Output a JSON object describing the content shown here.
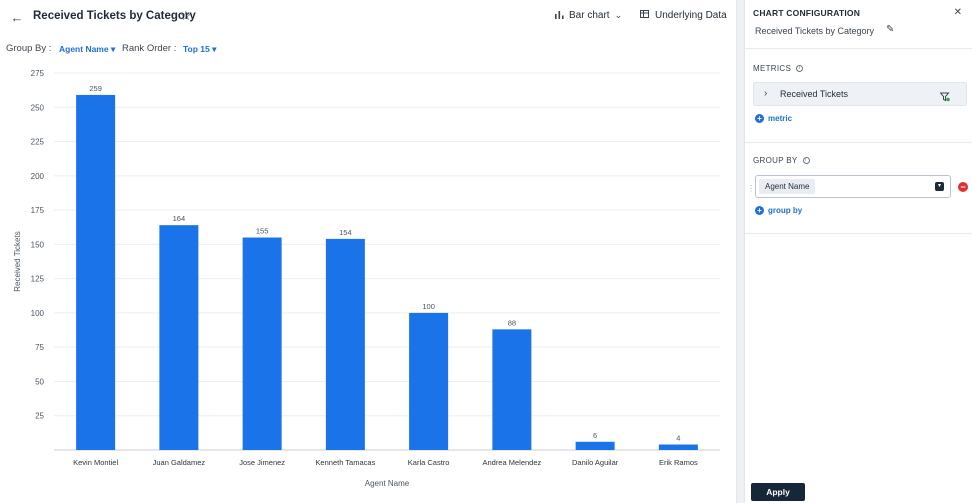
{
  "header": {
    "back_icon": "arrow-left-icon",
    "title": "Received Tickets by Category",
    "star_icon": "star-outline-icon",
    "chart_type_label": "Bar chart",
    "chart_type_icon": "bar-chart-icon",
    "underlying_label": "Underlying Data",
    "underlying_icon": "table-icon"
  },
  "toolbar": {
    "group_by_label": "Group By :",
    "group_by_value": "Agent Name",
    "rank_order_label": "Rank Order :",
    "rank_order_value": "Top 15"
  },
  "config": {
    "title": "CHART CONFIGURATION",
    "close_icon": "close-icon",
    "chart_name": "Received Tickets by Category",
    "edit_icon": "pencil-icon",
    "metrics_label": "METRICS",
    "metric_item": "Received Tickets",
    "add_metric": "metric",
    "group_by_label": "GROUP BY",
    "group_by_chip": "Agent Name",
    "add_group_by": "group by",
    "apply_label": "Apply"
  },
  "colors": {
    "bar": "#1a73e8",
    "accent": "#1f6fd6",
    "apply_bg": "#17273a",
    "remove": "#e0302f"
  },
  "chart_data": {
    "type": "bar",
    "categories": [
      "Kevin Montiel",
      "Juan Galdamez",
      "Jose Jimenez",
      "Kenneth Tamacas",
      "Karla Castro",
      "Andrea Melendez",
      "Danilo Aguilar",
      "Erik Ramos"
    ],
    "values": [
      259,
      164,
      155,
      154,
      100,
      88,
      6,
      4
    ],
    "xlabel": "Agent Name",
    "ylabel": "Received Tickets",
    "ylim": [
      0,
      275
    ],
    "yticks": [
      25,
      50,
      75,
      100,
      125,
      150,
      175,
      200,
      225,
      250,
      275
    ],
    "grid": true,
    "data_labels": true
  }
}
